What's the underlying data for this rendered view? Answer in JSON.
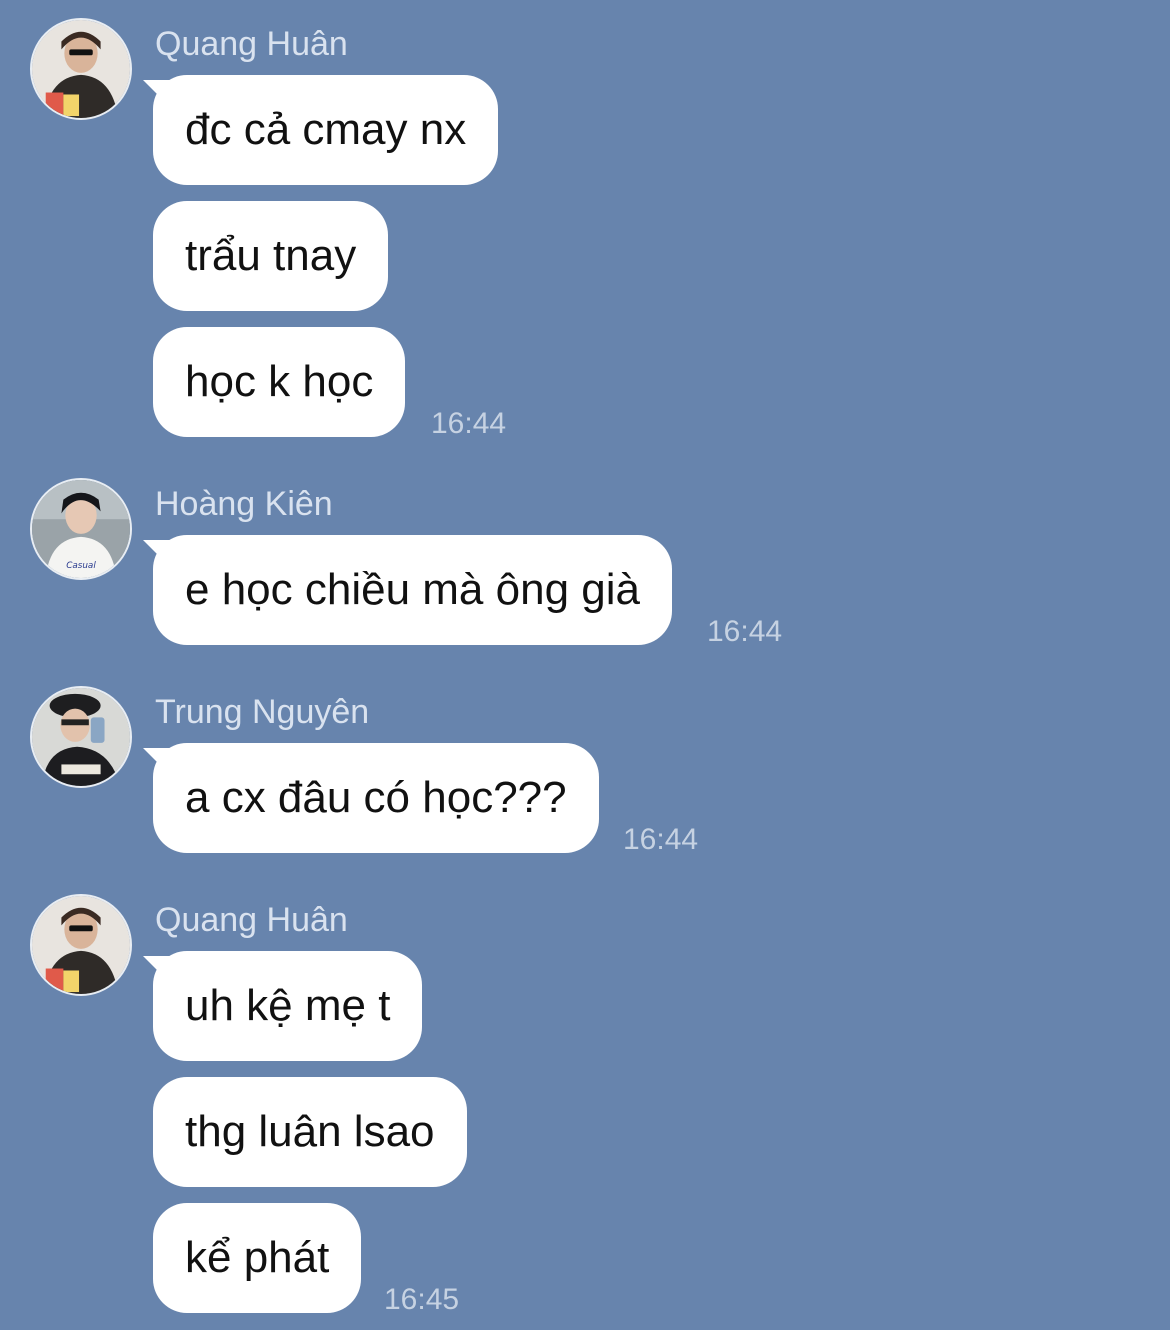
{
  "groups": [
    {
      "sender": "Quang Huân",
      "avatar": "avatar-quang-huan",
      "messages": [
        "đc cả cmay nx",
        "trẩu tnay",
        "học k học"
      ],
      "time": "16:44"
    },
    {
      "sender": "Hoàng Kiên",
      "avatar": "avatar-hoang-kien",
      "messages": [
        "e học chiều mà ông già"
      ],
      "time": "16:44"
    },
    {
      "sender": "Trung Nguyên",
      "avatar": "avatar-trung-nguyen",
      "messages": [
        "a cx đâu có học???"
      ],
      "time": "16:44"
    },
    {
      "sender": "Quang Huân",
      "avatar": "avatar-quang-huan",
      "messages": [
        "uh kệ mẹ t",
        "thg luân lsao",
        "kể phát"
      ],
      "time": "16:45"
    }
  ],
  "colors": {
    "background": "#6784ad",
    "bubble": "#ffffff",
    "sender_text": "#d9e2ef",
    "time_text": "#c6d2e2"
  }
}
